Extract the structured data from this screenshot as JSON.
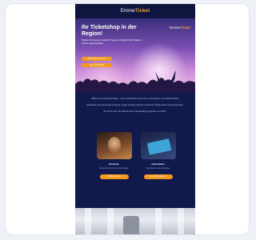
{
  "email": {
    "brand": {
      "prefix": "Emme",
      "suffix": "Ticket"
    },
    "hero": {
      "title": "Ihr Ticketshop in der Region!",
      "subtitle": "Tickets für Konzerte, Comedy, Theater und Sport in Ihrer Region – einfach online bestellen.",
      "primary_button": "Jetzt Tickets sichern",
      "secondary_button": "Zum Ticketshop"
    },
    "body": {
      "paragraphs": [
        "Willkommen bei EmmeTicket – Ihrem Ticketshop für Events in Ihrer Region und darüber hinaus.",
        "Entdecken Sie spannende Konzerte, lustige Comedy-Abende, packende Theaterstücke und Sportevents.",
        "Wir freuen uns, Sie bald bei einer Veranstaltung begrüßen zu dürfen."
      ]
    },
    "cards": [
      {
        "title": "Konzerte",
        "text": "Die besten Konzerte in Ihrer Nähe.",
        "button": "Mehr erfahren"
      },
      {
        "title": "Gutscheine",
        "text": "Verschenken Sie Erlebnisse.",
        "button": "Gutschein kaufen"
      }
    ]
  },
  "colors": {
    "background": "#111a4d",
    "accent": "#f39a1d",
    "brand_accent": "#f2a13a"
  }
}
